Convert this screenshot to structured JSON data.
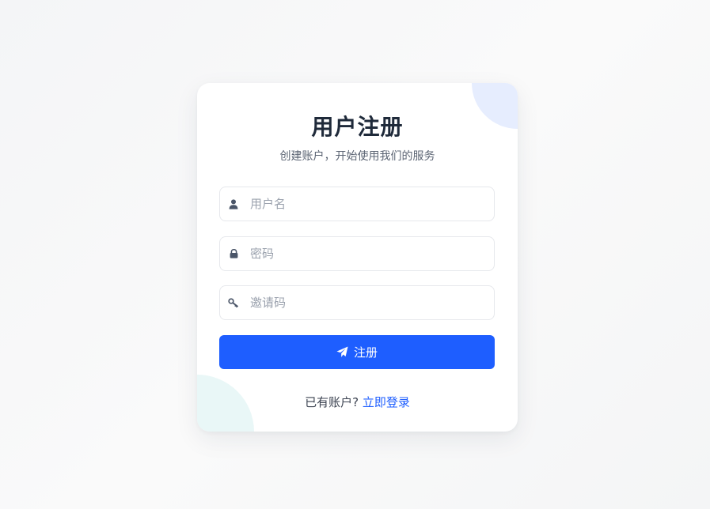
{
  "register": {
    "title": "用户注册",
    "subtitle": "创建账户，开始使用我们的服务",
    "fields": [
      {
        "icon": "user-icon",
        "placeholder": "用户名",
        "value": ""
      },
      {
        "icon": "lock-icon",
        "placeholder": "密码",
        "value": ""
      },
      {
        "icon": "key-icon",
        "placeholder": "邀请码",
        "value": ""
      }
    ],
    "submit": {
      "icon": "paper-plane-icon",
      "label": "注册"
    },
    "footer": {
      "prompt": "已有账户?",
      "link": "立即登录"
    }
  },
  "colors": {
    "primary": "#1e5eff",
    "title": "#1f2a3a",
    "deco_top_right": "#e6edfe",
    "deco_bottom_left": "#e9f7f7"
  }
}
